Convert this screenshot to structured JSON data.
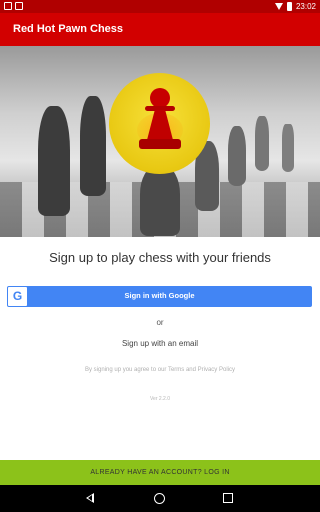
{
  "status_bar": {
    "time": "23:02",
    "icons": [
      "notification-icon",
      "notification-icon",
      "wifi-icon",
      "battery-icon"
    ]
  },
  "app_bar": {
    "title": "Red Hot Pawn Chess",
    "color": "#d20000"
  },
  "hero": {
    "logo": "red-pawn-logo",
    "logo_bg_color": "#e8c812"
  },
  "main": {
    "headline": "Sign up to play chess with your friends",
    "google_button": {
      "label": "Sign in with Google",
      "icon": "google-g-icon",
      "icon_letter": "G",
      "color": "#4285f4"
    },
    "or_text": "or",
    "email_link": "Sign up with an email",
    "terms_text": "By signing up you agree to our Terms and Privacy Policy",
    "version_text": "Ver 2.2.0"
  },
  "login_bar": {
    "label": "ALREADY HAVE AN ACCOUNT? LOG IN",
    "color": "#8cc21a"
  },
  "nav_bar": {
    "icons": [
      "back-icon",
      "home-icon",
      "recents-icon"
    ]
  }
}
